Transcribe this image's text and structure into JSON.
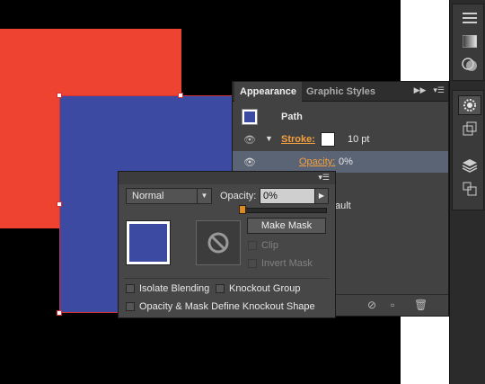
{
  "canvas": {
    "red_color": "#ee4330",
    "blue_color": "#3d4aa1"
  },
  "dock": {
    "icons": [
      "menu-icon",
      "gradient-icon",
      "shape-builder-icon",
      "appearance-icon",
      "transparency-icon",
      "layers-icon",
      "artboards-icon"
    ]
  },
  "appearance": {
    "tabs": [
      {
        "label": "Appearance",
        "active": true
      },
      {
        "label": "Graphic Styles",
        "active": false
      }
    ],
    "path_label": "Path",
    "stroke_label": "Stroke:",
    "stroke_weight": "10 pt",
    "opacity_label": "Opacity:",
    "opacity_value": "0%",
    "default_partial": "ault"
  },
  "transparency": {
    "blend_mode": "Normal",
    "opacity_label": "Opacity:",
    "opacity_value": "0%",
    "opacity_percent": 0,
    "make_mask_label": "Make Mask",
    "clip_label": "Clip",
    "invert_mask_label": "Invert Mask",
    "isolate_blending_label": "Isolate Blending",
    "knockout_group_label": "Knockout Group",
    "define_knockout_label": "Opacity & Mask Define Knockout Shape"
  }
}
